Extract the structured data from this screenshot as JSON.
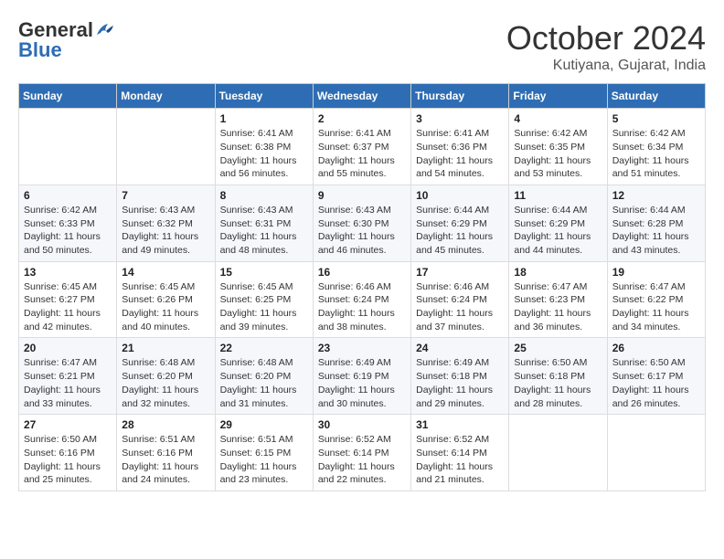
{
  "header": {
    "logo_general": "General",
    "logo_blue": "Blue",
    "month_title": "October 2024",
    "location": "Kutiyana, Gujarat, India"
  },
  "calendar": {
    "days_of_week": [
      "Sunday",
      "Monday",
      "Tuesday",
      "Wednesday",
      "Thursday",
      "Friday",
      "Saturday"
    ],
    "weeks": [
      [
        {
          "day": "",
          "info": ""
        },
        {
          "day": "",
          "info": ""
        },
        {
          "day": "1",
          "sunrise": "6:41 AM",
          "sunset": "6:38 PM",
          "daylight": "11 hours and 56 minutes."
        },
        {
          "day": "2",
          "sunrise": "6:41 AM",
          "sunset": "6:37 PM",
          "daylight": "11 hours and 55 minutes."
        },
        {
          "day": "3",
          "sunrise": "6:41 AM",
          "sunset": "6:36 PM",
          "daylight": "11 hours and 54 minutes."
        },
        {
          "day": "4",
          "sunrise": "6:42 AM",
          "sunset": "6:35 PM",
          "daylight": "11 hours and 53 minutes."
        },
        {
          "day": "5",
          "sunrise": "6:42 AM",
          "sunset": "6:34 PM",
          "daylight": "11 hours and 51 minutes."
        }
      ],
      [
        {
          "day": "6",
          "sunrise": "6:42 AM",
          "sunset": "6:33 PM",
          "daylight": "11 hours and 50 minutes."
        },
        {
          "day": "7",
          "sunrise": "6:43 AM",
          "sunset": "6:32 PM",
          "daylight": "11 hours and 49 minutes."
        },
        {
          "day": "8",
          "sunrise": "6:43 AM",
          "sunset": "6:31 PM",
          "daylight": "11 hours and 48 minutes."
        },
        {
          "day": "9",
          "sunrise": "6:43 AM",
          "sunset": "6:30 PM",
          "daylight": "11 hours and 46 minutes."
        },
        {
          "day": "10",
          "sunrise": "6:44 AM",
          "sunset": "6:29 PM",
          "daylight": "11 hours and 45 minutes."
        },
        {
          "day": "11",
          "sunrise": "6:44 AM",
          "sunset": "6:29 PM",
          "daylight": "11 hours and 44 minutes."
        },
        {
          "day": "12",
          "sunrise": "6:44 AM",
          "sunset": "6:28 PM",
          "daylight": "11 hours and 43 minutes."
        }
      ],
      [
        {
          "day": "13",
          "sunrise": "6:45 AM",
          "sunset": "6:27 PM",
          "daylight": "11 hours and 42 minutes."
        },
        {
          "day": "14",
          "sunrise": "6:45 AM",
          "sunset": "6:26 PM",
          "daylight": "11 hours and 40 minutes."
        },
        {
          "day": "15",
          "sunrise": "6:45 AM",
          "sunset": "6:25 PM",
          "daylight": "11 hours and 39 minutes."
        },
        {
          "day": "16",
          "sunrise": "6:46 AM",
          "sunset": "6:24 PM",
          "daylight": "11 hours and 38 minutes."
        },
        {
          "day": "17",
          "sunrise": "6:46 AM",
          "sunset": "6:24 PM",
          "daylight": "11 hours and 37 minutes."
        },
        {
          "day": "18",
          "sunrise": "6:47 AM",
          "sunset": "6:23 PM",
          "daylight": "11 hours and 36 minutes."
        },
        {
          "day": "19",
          "sunrise": "6:47 AM",
          "sunset": "6:22 PM",
          "daylight": "11 hours and 34 minutes."
        }
      ],
      [
        {
          "day": "20",
          "sunrise": "6:47 AM",
          "sunset": "6:21 PM",
          "daylight": "11 hours and 33 minutes."
        },
        {
          "day": "21",
          "sunrise": "6:48 AM",
          "sunset": "6:20 PM",
          "daylight": "11 hours and 32 minutes."
        },
        {
          "day": "22",
          "sunrise": "6:48 AM",
          "sunset": "6:20 PM",
          "daylight": "11 hours and 31 minutes."
        },
        {
          "day": "23",
          "sunrise": "6:49 AM",
          "sunset": "6:19 PM",
          "daylight": "11 hours and 30 minutes."
        },
        {
          "day": "24",
          "sunrise": "6:49 AM",
          "sunset": "6:18 PM",
          "daylight": "11 hours and 29 minutes."
        },
        {
          "day": "25",
          "sunrise": "6:50 AM",
          "sunset": "6:18 PM",
          "daylight": "11 hours and 28 minutes."
        },
        {
          "day": "26",
          "sunrise": "6:50 AM",
          "sunset": "6:17 PM",
          "daylight": "11 hours and 26 minutes."
        }
      ],
      [
        {
          "day": "27",
          "sunrise": "6:50 AM",
          "sunset": "6:16 PM",
          "daylight": "11 hours and 25 minutes."
        },
        {
          "day": "28",
          "sunrise": "6:51 AM",
          "sunset": "6:16 PM",
          "daylight": "11 hours and 24 minutes."
        },
        {
          "day": "29",
          "sunrise": "6:51 AM",
          "sunset": "6:15 PM",
          "daylight": "11 hours and 23 minutes."
        },
        {
          "day": "30",
          "sunrise": "6:52 AM",
          "sunset": "6:14 PM",
          "daylight": "11 hours and 22 minutes."
        },
        {
          "day": "31",
          "sunrise": "6:52 AM",
          "sunset": "6:14 PM",
          "daylight": "11 hours and 21 minutes."
        },
        {
          "day": "",
          "info": ""
        },
        {
          "day": "",
          "info": ""
        }
      ]
    ]
  }
}
